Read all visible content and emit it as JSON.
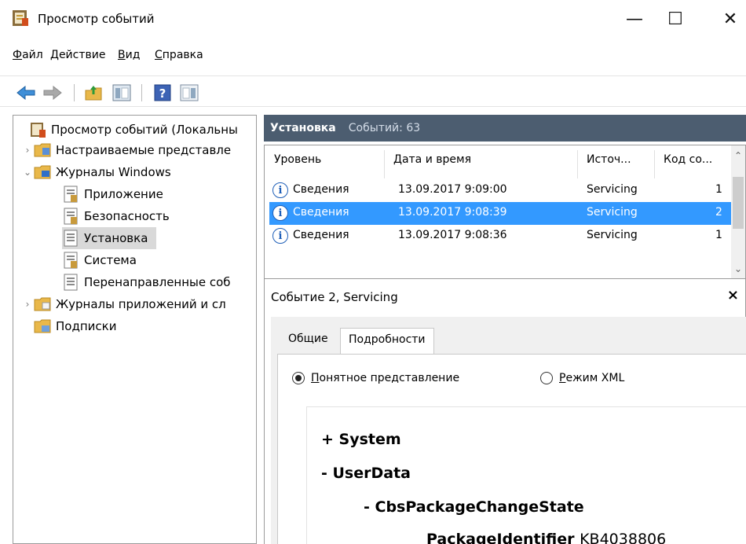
{
  "window": {
    "title": "Просмотр событий",
    "minimize_glyph": "—",
    "maximize_glyph": "☐",
    "close_glyph": "✕"
  },
  "menu": [
    {
      "label": "Файл",
      "accel": "Ф",
      "rest": "айл"
    },
    {
      "label": "Действие",
      "accel": "Д",
      "rest": "ействие"
    },
    {
      "label": "Вид",
      "accel": "В",
      "rest": "ид"
    },
    {
      "label": "Справка",
      "accel": "С",
      "rest": "правка"
    }
  ],
  "toolbar": [
    "back-arrow-icon",
    "forward-arrow-icon",
    "up-folder-icon",
    "show-hide-tree-icon",
    "help-icon",
    "action-pane-icon"
  ],
  "tree": {
    "root": "Просмотр событий (Локальны",
    "custom_views": "Настраиваемые представле",
    "windows_logs": "Журналы Windows",
    "application": "Приложение",
    "security": "Безопасность",
    "setup": "Установка",
    "system": "Система",
    "forwarded": "Перенаправленные соб",
    "app_services_logs": "Журналы приложений и сл",
    "subscriptions": "Подписки"
  },
  "log_header": {
    "name": "Установка",
    "count": "Событий: 63"
  },
  "event_list": {
    "columns": [
      "Уровень",
      "Дата и время",
      "Источ...",
      "Код со..."
    ],
    "rows": [
      {
        "level": "Сведения",
        "datetime": "13.09.2017 9:09:00",
        "source": "Servicing",
        "code": "1"
      },
      {
        "level": "Сведения",
        "datetime": "13.09.2017 9:08:39",
        "source": "Servicing",
        "code": "2"
      },
      {
        "level": "Сведения",
        "datetime": "13.09.2017 9:08:36",
        "source": "Servicing",
        "code": "1"
      }
    ],
    "selected_index": 1
  },
  "details": {
    "title": "Событие 2, Servicing",
    "close_glyph": "×",
    "tabs": [
      "Общие",
      "Подробности"
    ],
    "active_tab": "Подробности",
    "radio_friendly": {
      "accel": "П",
      "rest": "онятное представление"
    },
    "radio_xml": {
      "accel": "Р",
      "rest": "ежим XML"
    },
    "xml": {
      "system": "+  System",
      "userdata": "-  UserData",
      "cbs": "-  CbsPackageChangeState",
      "pkg_key": "PackageIdentifier",
      "pkg_val": "KB4038806"
    }
  }
}
